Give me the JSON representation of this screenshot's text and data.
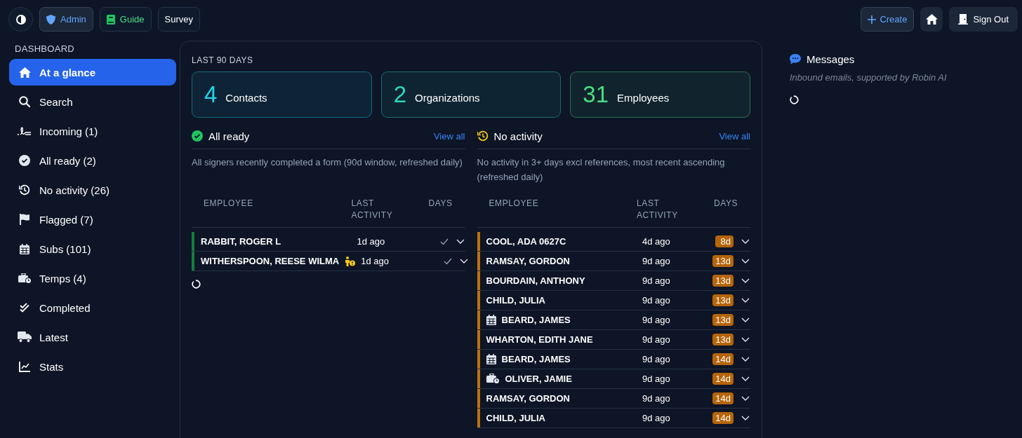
{
  "topbar": {
    "left_buttons": [
      {
        "kind": "theme"
      },
      {
        "kind": "shield",
        "label": "Admin",
        "color": "#60a5fa"
      },
      {
        "kind": "book",
        "label": "Guide",
        "color": "#4ade80"
      },
      {
        "kind": "plain",
        "label": "Survey",
        "color": "#ffffff"
      }
    ],
    "right_buttons": [
      {
        "kind": "create",
        "label": "Create",
        "color": "#60a5fa"
      },
      {
        "kind": "home"
      },
      {
        "kind": "door",
        "label": "Sign Out",
        "color": "#ffffff"
      }
    ]
  },
  "sidebar": {
    "heading": "DASHBOARD",
    "items": [
      {
        "kind": "home",
        "label": "At a glance",
        "selected": true
      },
      {
        "kind": "search",
        "label": "Search",
        "selected": false
      },
      {
        "kind": "signature",
        "label": "Incoming (1)",
        "selected": false
      },
      {
        "kind": "check-circle",
        "label": "All ready (2)",
        "selected": false
      },
      {
        "kind": "history",
        "label": "No activity (26)",
        "selected": false
      },
      {
        "kind": "flag",
        "label": "Flagged (7)",
        "selected": false
      },
      {
        "kind": "calendar",
        "label": "Subs (101)",
        "selected": false
      },
      {
        "kind": "temp",
        "label": "Temps (4)",
        "selected": false
      },
      {
        "kind": "double-check",
        "label": "Completed",
        "selected": false
      },
      {
        "kind": "truck",
        "label": "Latest",
        "selected": false
      },
      {
        "kind": "chart",
        "label": "Stats",
        "selected": false
      }
    ]
  },
  "dashboard": {
    "period": "LAST 90 DAYS",
    "stats": [
      {
        "value": "4",
        "label": "Contacts",
        "color": "#22d3ee"
      },
      {
        "value": "2",
        "label": "Organizations",
        "color": "#2dd4bf"
      },
      {
        "value": "31",
        "label": "Employees",
        "color": "#4ade80"
      }
    ],
    "sections": [
      {
        "kind": "ready",
        "title": "All ready",
        "link": "View all",
        "description": "All signers recently completed a form (90d window, refreshed daily)",
        "columns": [
          "EMPLOYEE",
          "LAST ACTIVITY",
          "DAYS"
        ],
        "loading": true,
        "rows": [
          {
            "kind": "plain",
            "name": "RABBIT, ROGER L",
            "last_activity": "1d ago",
            "color": "#15803d"
          },
          {
            "kind": "person-alert",
            "name": "WITHERSPOON, REESE WILMA",
            "last_activity": "1d ago",
            "color": "#15803d"
          }
        ]
      },
      {
        "kind": "idle",
        "title": "No activity",
        "link": "View all",
        "description": "No activity in 3+ days excl references, most recent ascending (refreshed daily)",
        "columns": [
          "EMPLOYEE",
          "LAST ACTIVITY",
          "DAYS"
        ],
        "rows": [
          {
            "kind": "plain",
            "name": "COOL, ADA 0627C",
            "last_activity": "4d ago",
            "days": "8d",
            "color": "#c2700c"
          },
          {
            "kind": "plain",
            "name": "RAMSAY, GORDON",
            "last_activity": "9d ago",
            "days": "13d",
            "color": "#c2700c"
          },
          {
            "kind": "plain",
            "name": "BOURDAIN, ANTHONY",
            "last_activity": "9d ago",
            "days": "13d",
            "color": "#c2700c"
          },
          {
            "kind": "plain",
            "name": "CHILD, JULIA",
            "last_activity": "9d ago",
            "days": "13d",
            "color": "#c2700c"
          },
          {
            "kind": "sub",
            "name": "BEARD, JAMES",
            "last_activity": "9d ago",
            "days": "13d",
            "color": "#c2700c"
          },
          {
            "kind": "plain",
            "name": "WHARTON, EDITH JANE",
            "last_activity": "9d ago",
            "days": "13d",
            "color": "#c2700c"
          },
          {
            "kind": "sub",
            "name": "BEARD, JAMES",
            "last_activity": "9d ago",
            "days": "14d",
            "color": "#c2700c"
          },
          {
            "kind": "temp",
            "name": "OLIVER, JAMIE",
            "last_activity": "9d ago",
            "days": "14d",
            "color": "#c2700c"
          },
          {
            "kind": "plain",
            "name": "RAMSAY, GORDON",
            "last_activity": "9d ago",
            "days": "14d",
            "color": "#c2700c"
          },
          {
            "kind": "plain",
            "name": "CHILD, JULIA",
            "last_activity": "9d ago",
            "days": "14d",
            "color": "#c2700c"
          }
        ]
      }
    ]
  },
  "messages": {
    "title": "Messages",
    "subtitle": "Inbound emails, supported by Robin AI",
    "loading": true
  }
}
